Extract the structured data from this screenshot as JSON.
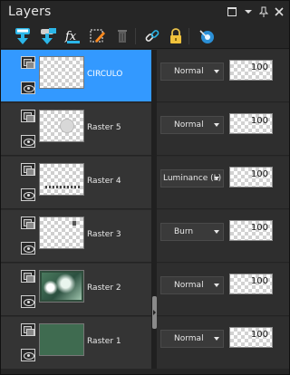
{
  "panel": {
    "title": "Layers",
    "controls": [
      "restore-icon",
      "menu-caret-icon",
      "pin-icon",
      "close-icon"
    ]
  },
  "toolbar": {
    "tools": [
      {
        "name": "new-raster-layer",
        "icon": "new-layer-icon"
      },
      {
        "name": "new-mask-layer",
        "icon": "new-mask-icon"
      },
      {
        "name": "layer-effects",
        "icon": "fx-icon"
      },
      {
        "name": "edit-selection",
        "icon": "edit-selection-icon"
      },
      {
        "name": "delete-layer",
        "icon": "trash-icon"
      },
      {
        "name": "link-layers",
        "icon": "link-icon"
      },
      {
        "name": "lock-transparency",
        "icon": "lock-icon"
      },
      {
        "name": "view-toggle",
        "icon": "eye-globe-icon"
      }
    ]
  },
  "layers": [
    {
      "name": "CIRCULO",
      "blend": "Normal",
      "opacity": "100",
      "selected": true
    },
    {
      "name": "Raster 5",
      "blend": "Normal",
      "opacity": "100",
      "selected": false
    },
    {
      "name": "Raster 4",
      "blend": "Luminance (L)",
      "opacity": "100",
      "selected": false
    },
    {
      "name": "Raster 3",
      "blend": "Burn",
      "opacity": "100",
      "selected": false
    },
    {
      "name": "Raster 2",
      "blend": "Normal",
      "opacity": "100",
      "selected": false
    },
    {
      "name": "Raster 1",
      "blend": "Normal",
      "opacity": "100",
      "selected": false
    }
  ],
  "colors": {
    "selected": "#3399ff",
    "panel_bg": "#2b2b2b",
    "raster1_fill": "#3f6b50"
  }
}
